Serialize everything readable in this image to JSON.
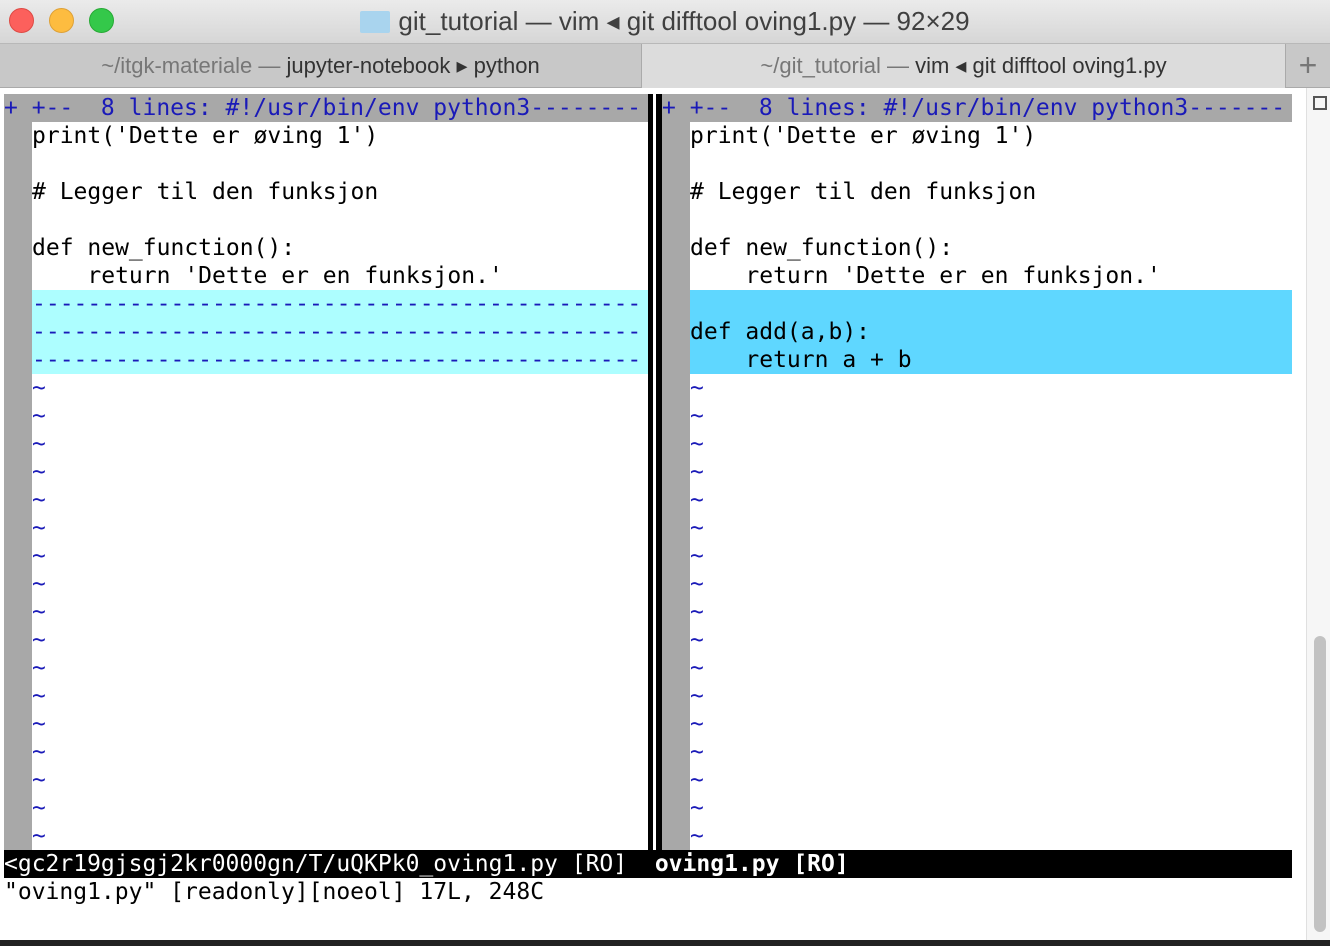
{
  "window": {
    "title": "git_tutorial — vim ◂ git difftool oving1.py — 92×29",
    "icon": "folder-icon"
  },
  "tabs": [
    {
      "dim": "~/itgk-materiale — ",
      "main": "jupyter-notebook ▸ python",
      "active": false
    },
    {
      "dim": "~/git_tutorial — ",
      "main": "vim ◂ git difftool oving1.py",
      "active": true
    }
  ],
  "new_tab": "+",
  "left": {
    "fold": "+ +--  8 lines: #!/usr/bin/env python3--------",
    "lines": [
      "print('Dette er øving 1')",
      "",
      "# Legger til den funksjon",
      "",
      "def new_function():",
      "    return 'Dette er en funksjon.'"
    ],
    "deleted": [
      "--------------------------------------------",
      "--------------------------------------------",
      "--------------------------------------------"
    ]
  },
  "right": {
    "fold": "+ +--  8 lines: #!/usr/bin/env python3-------",
    "lines": [
      "print('Dette er øving 1')",
      "",
      "# Legger til den funksjon",
      "",
      "def new_function():",
      "    return 'Dette er en funksjon.'"
    ],
    "added": [
      "",
      "def add(a,b):",
      "    return a + b"
    ]
  },
  "tilde": "~",
  "status": {
    "left": "<gc2r19gjsgj2kr0000gn/T/uQKPk0_oving1.py [RO]",
    "right": "oving1.py [RO]"
  },
  "command_line": "\"oving1.py\" [readonly][noeol] 17L, 248C",
  "colors": {
    "added": "#5fd7ff",
    "changed_filler": "#adfeff",
    "fold": "#a8a8a8",
    "tilde": "#1a1ab8"
  }
}
